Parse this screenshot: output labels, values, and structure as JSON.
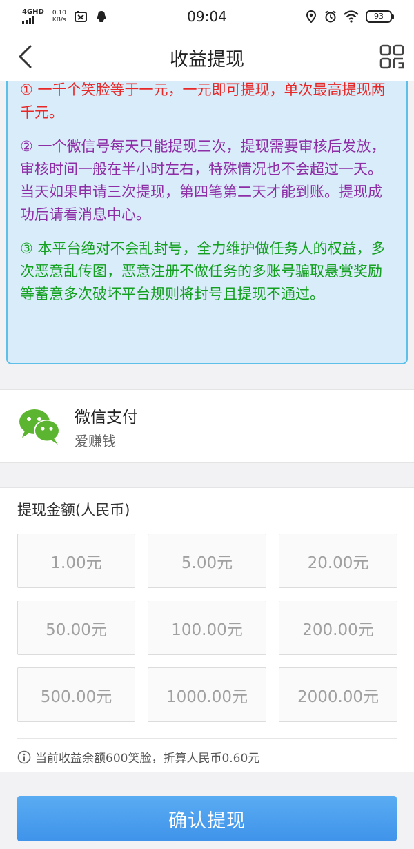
{
  "status_bar": {
    "network": "4GHD",
    "speed_value": "0.10",
    "speed_unit": "KB/s",
    "time": "09:04",
    "battery": "93"
  },
  "nav": {
    "title": "收益提现",
    "back_icon": "chevron-left-icon",
    "right_icon": "qr-grid-icon"
  },
  "notice": {
    "rule1": "① 一千个笑脸等于一元，一元即可提现，单次最高提现两千元。",
    "rule2": "② 一个微信号每天只能提现三次，提现需要审核后发放，审核时间一般在半小时左右，特殊情况也不会超过一天。当天如果申请三次提现，第四笔第二天才能到账。提现成功后请看消息中心。",
    "rule3": "③ 本平台绝对不会乱封号，全力维护做任务人的权益，多次恶意乱传图，恶意注册不做任务的多账号骗取悬赏奖励等蓄意多次破坏平台规则将封号且提现不通过。",
    "colors": {
      "rule1": "#e82727",
      "rule2": "#8e2ea6",
      "rule3": "#12a01e",
      "background": "#d8ecfa",
      "border": "#5ec0e8"
    }
  },
  "payment": {
    "method": "微信支付",
    "account": "爱赚钱",
    "icon": "wechat-icon"
  },
  "amount": {
    "label": "提现金额(人民币)",
    "options": [
      {
        "label": "1.00元"
      },
      {
        "label": "5.00元"
      },
      {
        "label": "20.00元"
      },
      {
        "label": "50.00元"
      },
      {
        "label": "100.00元"
      },
      {
        "label": "200.00元"
      },
      {
        "label": "500.00元"
      },
      {
        "label": "1000.00元"
      },
      {
        "label": "2000.00元"
      }
    ],
    "balance_info": "当前收益余额600笑脸，折算人民币0.60元"
  },
  "confirm": {
    "label": "确认提现",
    "color": "#4a9ff0"
  }
}
